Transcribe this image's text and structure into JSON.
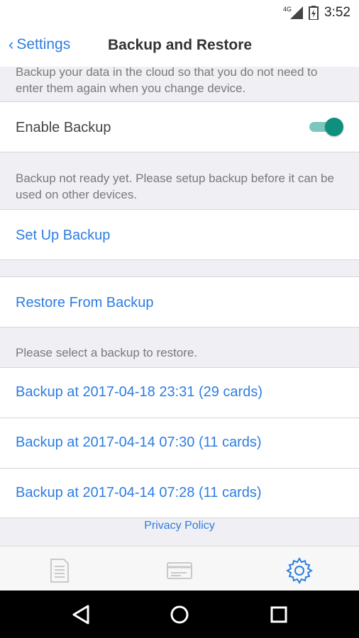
{
  "status_bar": {
    "network": "4G",
    "time": "3:52"
  },
  "header": {
    "back_label": "Settings",
    "title": "Backup and Restore"
  },
  "backup_section": {
    "description": "Backup your data in the cloud so that you do not need to enter them again when you change device.",
    "enable_label": "Enable Backup",
    "enabled": true,
    "status_note": "Backup not ready yet. Please setup backup before it can be used on other devices.",
    "setup_label": "Set Up Backup"
  },
  "restore_section": {
    "restore_label": "Restore From Backup",
    "select_note": "Please select a backup to restore.",
    "backups": [
      {
        "label": "Backup at 2017-04-18 23:31 (29 cards)"
      },
      {
        "label": "Backup at 2017-04-14 07:30 (11 cards)"
      },
      {
        "label": "Backup at 2017-04-14 07:28 (11 cards)"
      }
    ]
  },
  "footer": {
    "privacy_label": "Privacy Policy"
  },
  "tab_bar": {
    "tabs": [
      "document-icon",
      "card-icon",
      "gear-icon"
    ],
    "active_tab": "gear-icon"
  },
  "colors": {
    "link": "#2d7de0",
    "toggle_on": "#0f8f7d",
    "background": "#efeff4"
  }
}
